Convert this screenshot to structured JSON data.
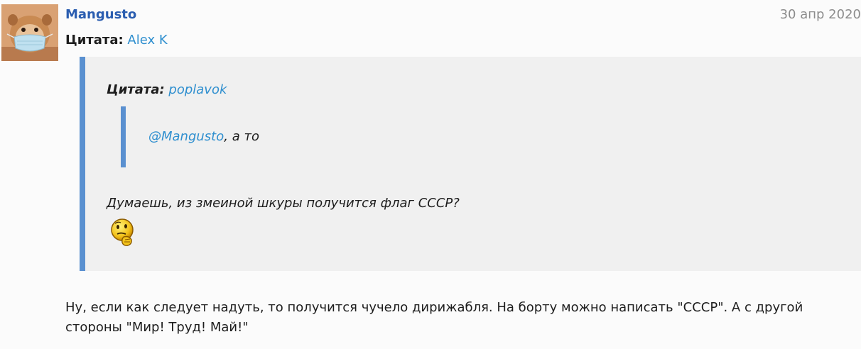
{
  "post": {
    "author": "Mangusto",
    "date": "30 апр 2020",
    "avatar_icon": "mongoose-with-mask-avatar",
    "quote": {
      "label": "Цитата:",
      "author": "Alex K",
      "nested_quote": {
        "label": "Цитата:",
        "author": "poplavok",
        "mention": "@Mangusto",
        "text_after_mention": ", а то"
      },
      "text": "Думаешь, из змеиной шкуры получится флаг СССР?",
      "smiley": "thinking-smiley-icon"
    },
    "reply_text": "Ну, если как следует надуть, то получится чучело дирижабля. На борту можно написать \"СССР\". А с другой стороны \"Мир! Труд! Май!\""
  },
  "colors": {
    "author_link": "#2a5db0",
    "link": "#2f8fcf",
    "quote_bar": "#5a90d0",
    "quote_bg": "#f0f0f0",
    "date": "#8c8c8c"
  }
}
